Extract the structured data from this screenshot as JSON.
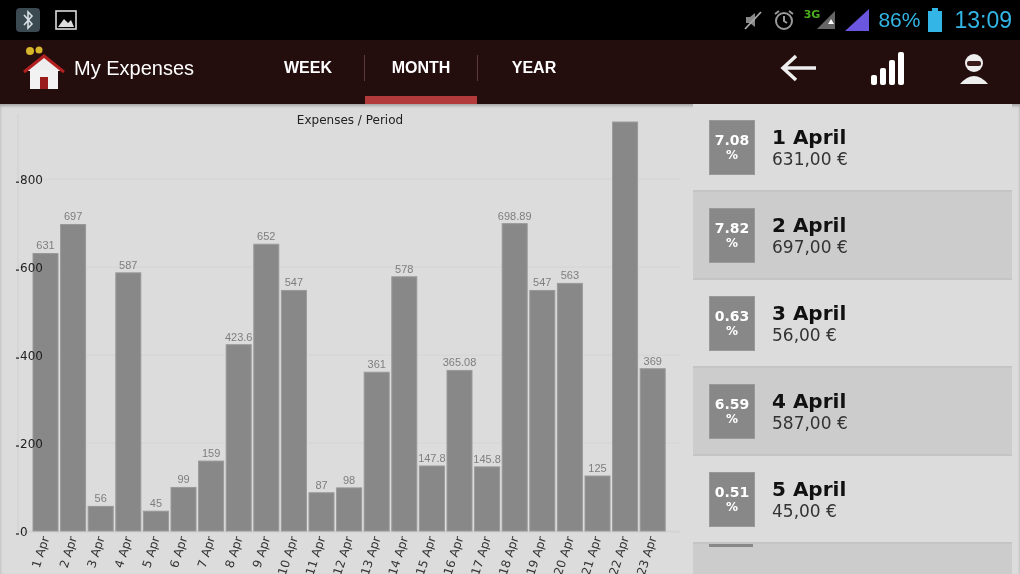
{
  "status_bar": {
    "network": "3G",
    "battery": "86%",
    "time": "13:09"
  },
  "app_bar": {
    "title": "My Expenses",
    "tabs": [
      {
        "label": "WEEK",
        "selected": false
      },
      {
        "label": "MONTH",
        "selected": true
      },
      {
        "label": "YEAR",
        "selected": false
      }
    ]
  },
  "chart": {
    "chart_data": {
      "type": "bar",
      "title": "Expenses / Period",
      "categories": [
        "1 Apr",
        "2 Apr",
        "3 Apr",
        "4 Apr",
        "5 Apr",
        "6 Apr",
        "7 Apr",
        "8 Apr",
        "9 Apr",
        "10 Apr",
        "11 Apr",
        "12 Apr",
        "13 Apr",
        "14 Apr",
        "15 Apr",
        "16 Apr",
        "17 Apr",
        "18 Apr",
        "19 Apr",
        "20 Apr",
        "21 Apr",
        "22 Apr",
        "23 Apr"
      ],
      "values": [
        631,
        697,
        56,
        587,
        45,
        99,
        159,
        423.6,
        652,
        547,
        87,
        98,
        361,
        578,
        147.8,
        365.08,
        145.8,
        698.89,
        547,
        563,
        125,
        930,
        369
      ],
      "value_labels": [
        "631",
        "697",
        "56",
        "587",
        "45",
        "99",
        "159",
        "423.6",
        "652",
        "547",
        "87",
        "98",
        "361",
        "578",
        "147.8",
        "365.08",
        "145.8",
        "698.89",
        "547",
        "563",
        "125",
        null,
        "369"
      ],
      "ylim": [
        0,
        930
      ],
      "yticks": [
        0,
        200,
        400,
        600,
        800
      ]
    }
  },
  "days": [
    {
      "percent": "7.08",
      "unit": "%",
      "date": "1 April",
      "amount": "631,00 €"
    },
    {
      "percent": "7.82",
      "unit": "%",
      "date": "2 April",
      "amount": "697,00 €"
    },
    {
      "percent": "0.63",
      "unit": "%",
      "date": "3 April",
      "amount": "56,00 €"
    },
    {
      "percent": "6.59",
      "unit": "%",
      "date": "4 April",
      "amount": "587,00 €"
    },
    {
      "percent": "0.51",
      "unit": "%",
      "date": "5 April",
      "amount": "45,00 €"
    }
  ]
}
